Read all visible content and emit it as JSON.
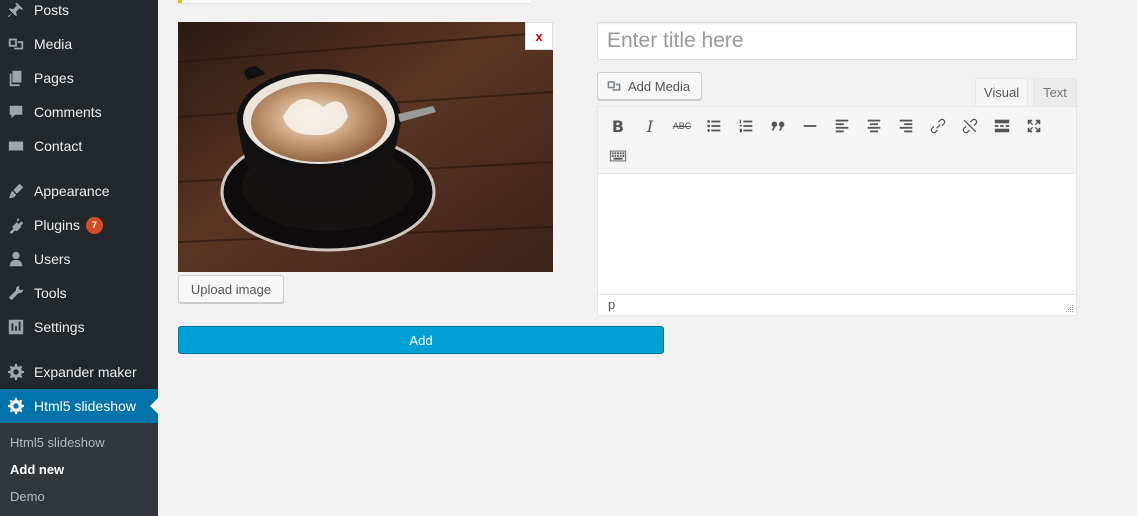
{
  "sidebar": {
    "items": [
      {
        "label": "Posts",
        "icon": "pin-icon"
      },
      {
        "label": "Media",
        "icon": "media-icon"
      },
      {
        "label": "Pages",
        "icon": "pages-icon"
      },
      {
        "label": "Comments",
        "icon": "comments-icon"
      },
      {
        "label": "Contact",
        "icon": "mail-icon"
      },
      {
        "label": "Appearance",
        "icon": "brush-icon"
      },
      {
        "label": "Plugins",
        "icon": "plug-icon",
        "badge": "7"
      },
      {
        "label": "Users",
        "icon": "user-icon"
      },
      {
        "label": "Tools",
        "icon": "wrench-icon"
      },
      {
        "label": "Settings",
        "icon": "settings-icon"
      },
      {
        "label": "Expander maker",
        "icon": "gear-icon"
      },
      {
        "label": "Html5 slideshow",
        "icon": "gear-icon"
      }
    ],
    "submenu": [
      "Html5 slideshow",
      "Add new",
      "Demo"
    ],
    "active_item": "Html5 slideshow",
    "active_subitem": "Add new"
  },
  "slide": {
    "remove_label": "x",
    "upload_label": "Upload image",
    "image_alt": "coffee-cup-photo"
  },
  "editor": {
    "title_placeholder": "Enter title here",
    "add_media_label": "Add Media",
    "tab_visual": "Visual",
    "tab_text": "Text",
    "status_path": "p"
  },
  "actions": {
    "add_label": "Add"
  },
  "colors": {
    "sidebar_bg": "#23282d",
    "active_bg": "#0073aa",
    "primary_button": "#00a0d2",
    "badge": "#d54e21"
  }
}
